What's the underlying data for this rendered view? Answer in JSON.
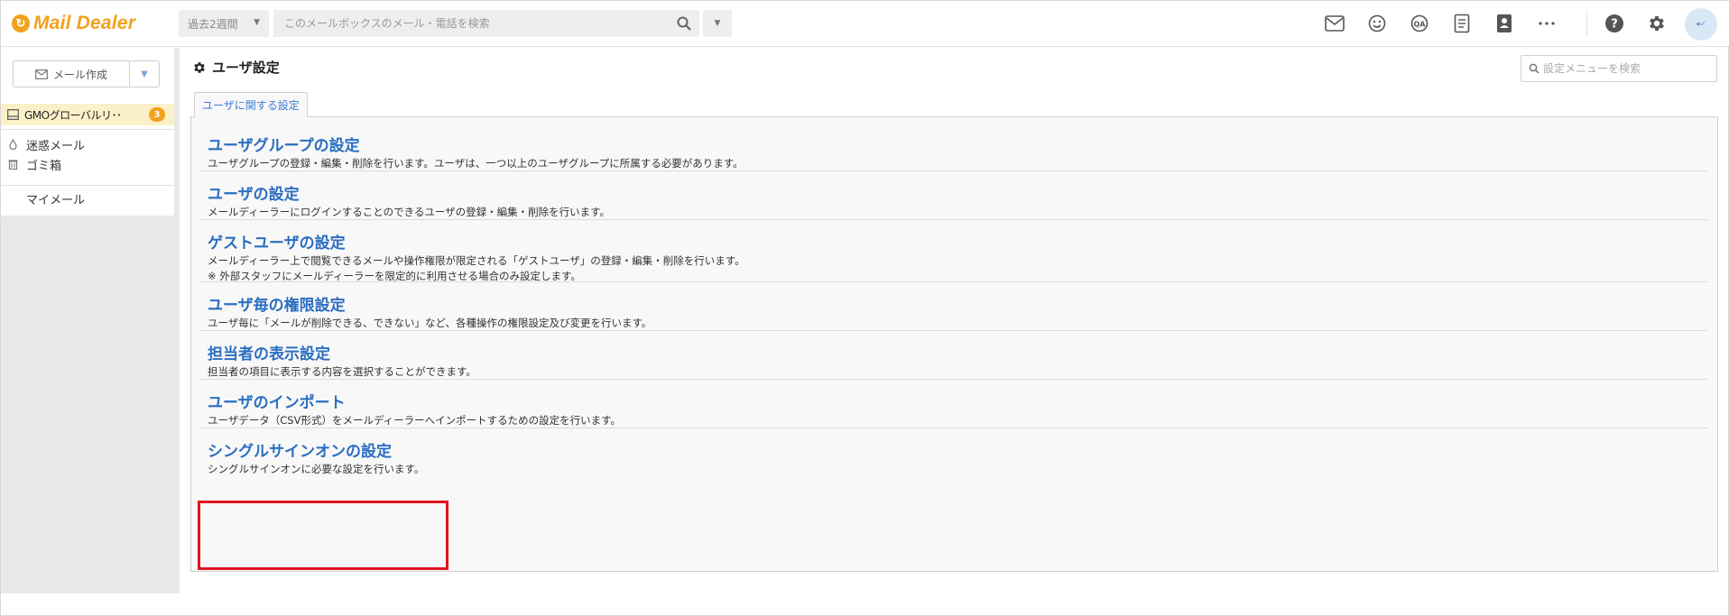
{
  "header": {
    "logo_text": "Mail Dealer",
    "period_label": "過去2週間",
    "search_placeholder": "このメールボックスのメール・電話を検索",
    "icons": [
      "mail-icon",
      "smile-icon",
      "qa-icon",
      "document-icon",
      "contact-book-icon",
      "more-icon",
      "help-icon",
      "gear-icon",
      "avatar"
    ]
  },
  "sidebar": {
    "compose_label": "メール作成",
    "mailbox": {
      "label": "GMOグローバルリ･･",
      "badge": "3"
    },
    "items": [
      {
        "label": "迷惑メール",
        "icon": "drop-icon"
      },
      {
        "label": "ゴミ箱",
        "icon": "trash-icon"
      },
      {
        "label": "マイメール",
        "icon": ""
      }
    ]
  },
  "main": {
    "title": "ユーザ設定",
    "menu_search_placeholder": "設定メニューを検索",
    "tab_label": "ユーザに関する設定",
    "settings": [
      {
        "title": "ユーザグループの設定",
        "desc": "ユーザグループの登録・編集・削除を行います。ユーザは、一つ以上のユーザグループに所属する必要があります。"
      },
      {
        "title": "ユーザの設定",
        "desc": "メールディーラーにログインすることのできるユーザの登録・編集・削除を行います。"
      },
      {
        "title": "ゲストユーザの設定",
        "desc": "メールディーラー上で閲覧できるメールや操作権限が限定される「ゲストユーザ」の登録・編集・削除を行います。",
        "desc2": "※ 外部スタッフにメールディーラーを限定的に利用させる場合のみ設定します。"
      },
      {
        "title": "ユーザ毎の権限設定",
        "desc": "ユーザ毎に「メールが削除できる、できない」など、各種操作の権限設定及び変更を行います。"
      },
      {
        "title": "担当者の表示設定",
        "desc": "担当者の項目に表示する内容を選択することができます。"
      },
      {
        "title": "ユーザのインポート",
        "desc": "ユーザデータ（CSV形式）をメールディーラーへインポートするための設定を行います。"
      },
      {
        "title": "シングルサインオンの設定",
        "desc": "シングルサインオンに必要な設定を行います。"
      }
    ]
  },
  "colors": {
    "brand": "#f2a21b",
    "link": "#2a6ec2",
    "highlight": "#e0141e",
    "mailbox_bg": "#fbf0c8"
  }
}
